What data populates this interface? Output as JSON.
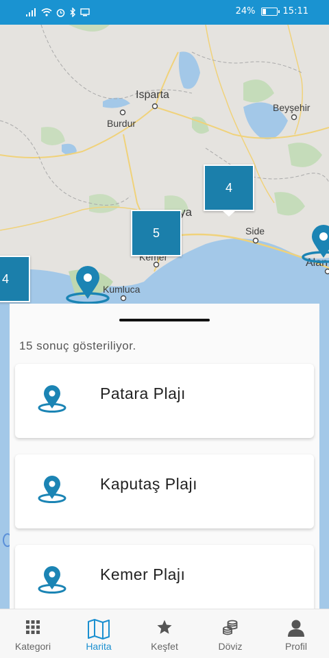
{
  "status_bar": {
    "battery": "24%",
    "battery_level": 0.24,
    "time": "15:11"
  },
  "map": {
    "cities": [
      {
        "id": "isparta",
        "name": "Isparta"
      },
      {
        "id": "burdur",
        "name": "Burdur"
      },
      {
        "id": "beysehir",
        "name": "Beyşehir"
      },
      {
        "id": "antalya",
        "name": "ya"
      },
      {
        "id": "side",
        "name": "Side"
      },
      {
        "id": "kemer",
        "name": "Kemer"
      },
      {
        "id": "kumluca",
        "name": "Kumluca"
      },
      {
        "id": "alanya",
        "name": "Alan"
      }
    ],
    "clusters": [
      {
        "id": "c1",
        "count": "4"
      },
      {
        "id": "c2",
        "count": "5"
      },
      {
        "id": "c3",
        "count": "4"
      }
    ]
  },
  "results": {
    "count_text": "15 sonuç gösteriliyor.",
    "items": [
      {
        "name": "Patara Plajı"
      },
      {
        "name": "Kaputaş Plajı"
      },
      {
        "name": "Kemer Plajı"
      }
    ]
  },
  "tabs": [
    {
      "label": "Kategori",
      "icon": "grid-icon"
    },
    {
      "label": "Harita",
      "icon": "map-icon",
      "active": true
    },
    {
      "label": "Keşfet",
      "icon": "star-icon"
    },
    {
      "label": "Döviz",
      "icon": "coins-icon"
    },
    {
      "label": "Profil",
      "icon": "person-icon"
    }
  ],
  "colors": {
    "accent": "#1a93d1",
    "pin": "#1b84b4",
    "cluster": "#1b7fab",
    "sea": "#a3c8e8"
  }
}
